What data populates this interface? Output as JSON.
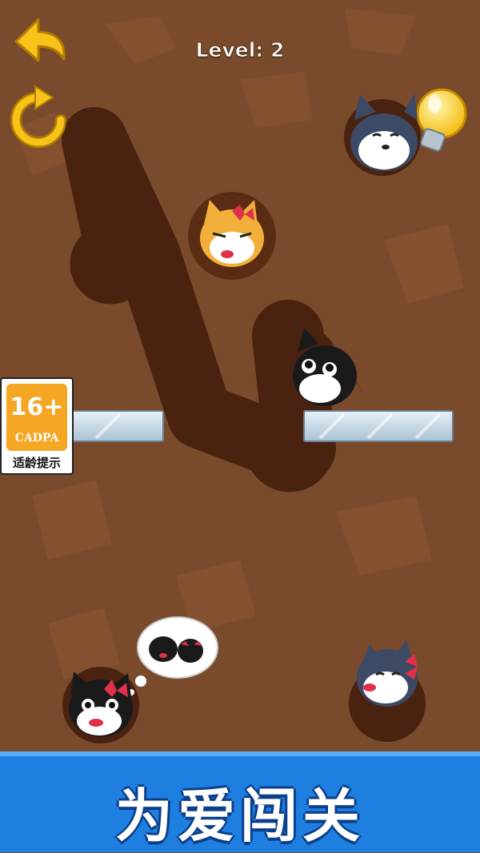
{
  "level": {
    "label": "Level: 2"
  },
  "age_rating": {
    "age": "16+",
    "org": "CADPA",
    "tip": "适龄提示",
    "color": "#f5a623"
  },
  "banner": {
    "text": "为爱闯关",
    "color": "#1f7fe0"
  },
  "icons": {
    "back": "back-arrow-icon",
    "restart": "restart-icon",
    "hint": "lightbulb-hint-icon"
  },
  "characters": [
    {
      "id": "husky-top",
      "kind": "husky"
    },
    {
      "id": "shiba",
      "kind": "shiba-with-bow"
    },
    {
      "id": "black-cat-top",
      "kind": "black-cat"
    },
    {
      "id": "black-cat-girl",
      "kind": "black-cat-with-bow"
    },
    {
      "id": "husky-girl",
      "kind": "husky-with-bow"
    }
  ],
  "colors": {
    "dirt": "#7a4a2c",
    "tunnel": "#4a2210",
    "glass": "#c8dbe8",
    "accent": "#f7c21a"
  }
}
